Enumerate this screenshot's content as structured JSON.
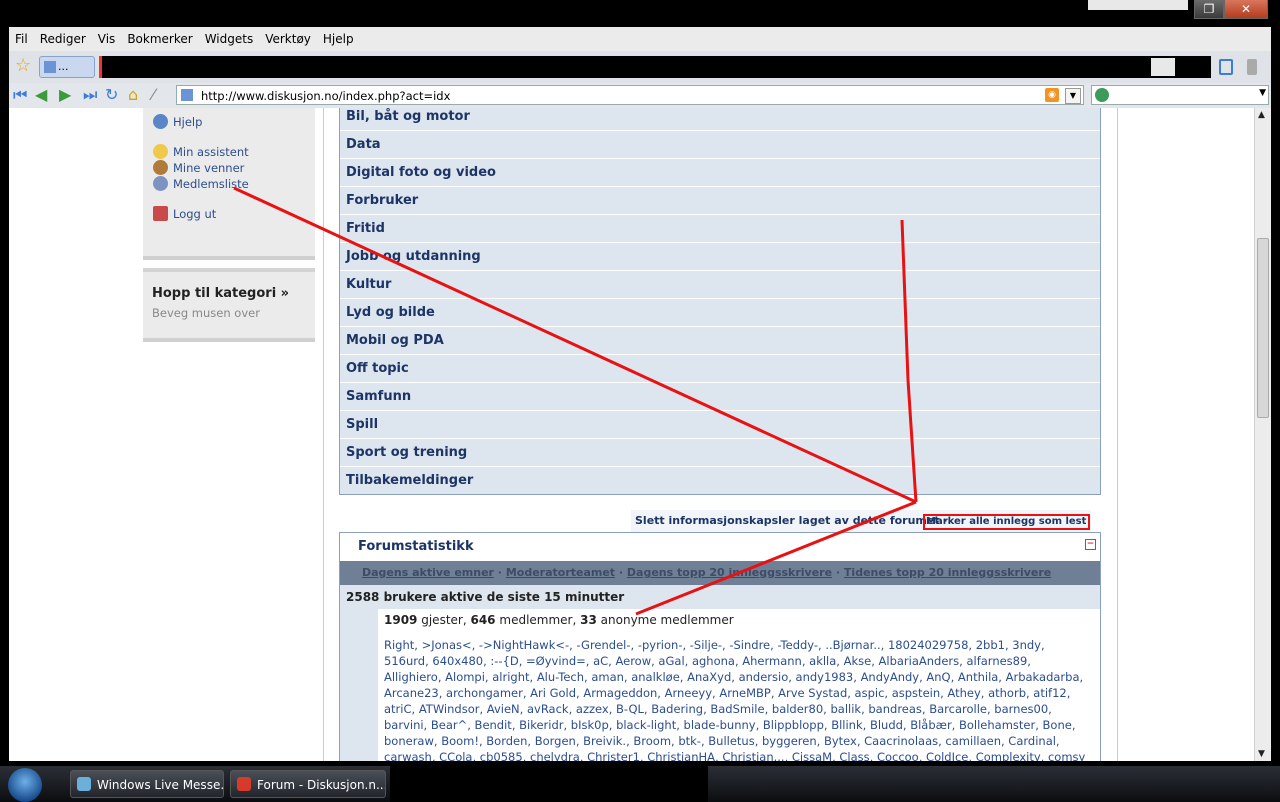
{
  "menu": [
    "Fil",
    "Rediger",
    "Vis",
    "Bokmerker",
    "Widgets",
    "Verktøy",
    "Hjelp"
  ],
  "tab": {
    "label": "..."
  },
  "address": {
    "url": "http://www.diskusjon.no/index.php?act=idx"
  },
  "sidebar": {
    "links": [
      {
        "label": "Hjelp",
        "icon": "help-icon"
      },
      {
        "label": "Min assistent",
        "icon": "assistant-icon"
      },
      {
        "label": "Mine venner",
        "icon": "friends-icon"
      },
      {
        "label": "Medlemsliste",
        "icon": "members-icon"
      },
      {
        "label": "Logg ut",
        "icon": "logout-icon"
      }
    ],
    "jump_title": "Hopp til kategori »",
    "jump_sub": "Beveg musen over"
  },
  "forums": [
    "Bil, båt og motor",
    "Data",
    "Digital foto og video",
    "Forbruker",
    "Fritid",
    "Jobb og utdanning",
    "Kultur",
    "Lyd og bilde",
    "Mobil og PDA",
    "Off topic",
    "Samfunn",
    "Spill",
    "Sport og trening",
    "Tilbakemeldinger"
  ],
  "mark_bar": {
    "delete_cookies": "Slett informasjonskapsler laget av dette forumet",
    "mark_read": "Marker alle innlegg som lest"
  },
  "stats": {
    "title": "Forumstatistikk",
    "links": [
      "Dagens aktive emner",
      "Moderatorteamet",
      "Dagens topp 20 innleggsskrivere",
      "Tidenes topp 20 innleggsskrivere"
    ],
    "active_users": "2588 brukere aktive de siste 15 minutter",
    "guests": "1909",
    "guests_label": "gjester,",
    "members": "646",
    "members_label": "medlemmer,",
    "anon": "33",
    "anon_label": "anonyme medlemmer",
    "names": [
      "Right, >Jonas<, ->NightHawk<-, -Grendel-, -pyrion-, -Silje-, -Sindre, -Teddy-, ..Bjørnar.., 18024029758, 2bb1, 3ndy,",
      "516urd, 640x480, :--{D, =Øyvind=, aC, Aerow, aGal, aghona, Ahermann, aklla, Akse, AlbariaAnders, alfarnes89,",
      "Allighiero, Alompi, alright, Alu-Tech, aman, analkløe, AnaXyd, andersio, andy1983, AndyAndy, AnQ, Anthila, Arbakadarba,",
      "Arcane23, archongamer, Ari Gold, Armageddon, Arneeyy, ArneMBP, Arve Systad, aspic, aspstein, Athey, athorb, atif12,",
      "atriC, ATWindsor, AvieN, avRack, azzex, B-QL, Badering, BadSmile, balder80, ballik, bandreas, Barcarolle, barnes00,",
      "barvini, Bear^, Bendit, Bikeridr, bIsk0p, black-light, blade-bunny, Blippblopp, Bllink, Bludd, Blåbær, Bollehamster, Bone,",
      "boneraw, Boom!, Borden, Borgen, Breivik., Broom, btk-, Bulletus, byggeren, Bytex, Caacrinolaas, camillaen, Cardinal,",
      "carwash, CCola, cb0585, chelydra, Christer1, ChristianHA, Christian..., CissaM, Class, Coccoo, ColdIce, Complexity, comsy"
    ]
  },
  "taskbar": {
    "tasks": [
      "Windows Live Messe...",
      "Forum - Diskusjon.n..."
    ]
  },
  "colors": {
    "accent": "#1d3566",
    "link": "#2c4d8e",
    "annotation": "#e81212",
    "forum_row": "#dde5ef"
  }
}
